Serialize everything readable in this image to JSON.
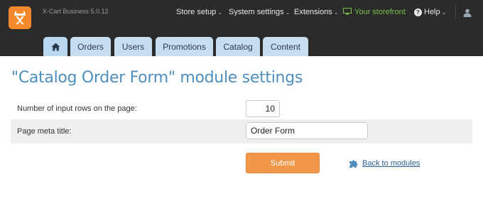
{
  "header": {
    "brand": "X-Cart Business 5.0.12",
    "menu": {
      "store_setup": "Store setup",
      "system_settings": "System settings",
      "extensions": "Extensions",
      "storefront": "Your storefront",
      "help": "Help"
    },
    "caret": "⌄"
  },
  "tabs": [
    "Orders",
    "Users",
    "Promotions",
    "Catalog",
    "Content"
  ],
  "page": {
    "title": "\"Catalog Order Form\" module settings"
  },
  "form": {
    "rows_label": "Number of input rows on the page:",
    "rows_value": "10",
    "meta_label": "Page meta title:",
    "meta_value": "Order Form"
  },
  "actions": {
    "submit_label": "Submit",
    "back_label": "Back to modules"
  },
  "icons": {
    "logo": "xcart-logo-icon",
    "home": "home-icon",
    "monitor": "monitor-icon",
    "help": "help-icon",
    "user": "user-icon",
    "puzzle": "puzzle-icon"
  },
  "colors": {
    "accent_orange": "#f5892b",
    "tab_bg": "#c6def0",
    "title_blue": "#4e8fbd",
    "link_blue": "#2a5f8f",
    "storefront_green": "#7cc04a",
    "topbar_bg": "#2b2b2b"
  }
}
